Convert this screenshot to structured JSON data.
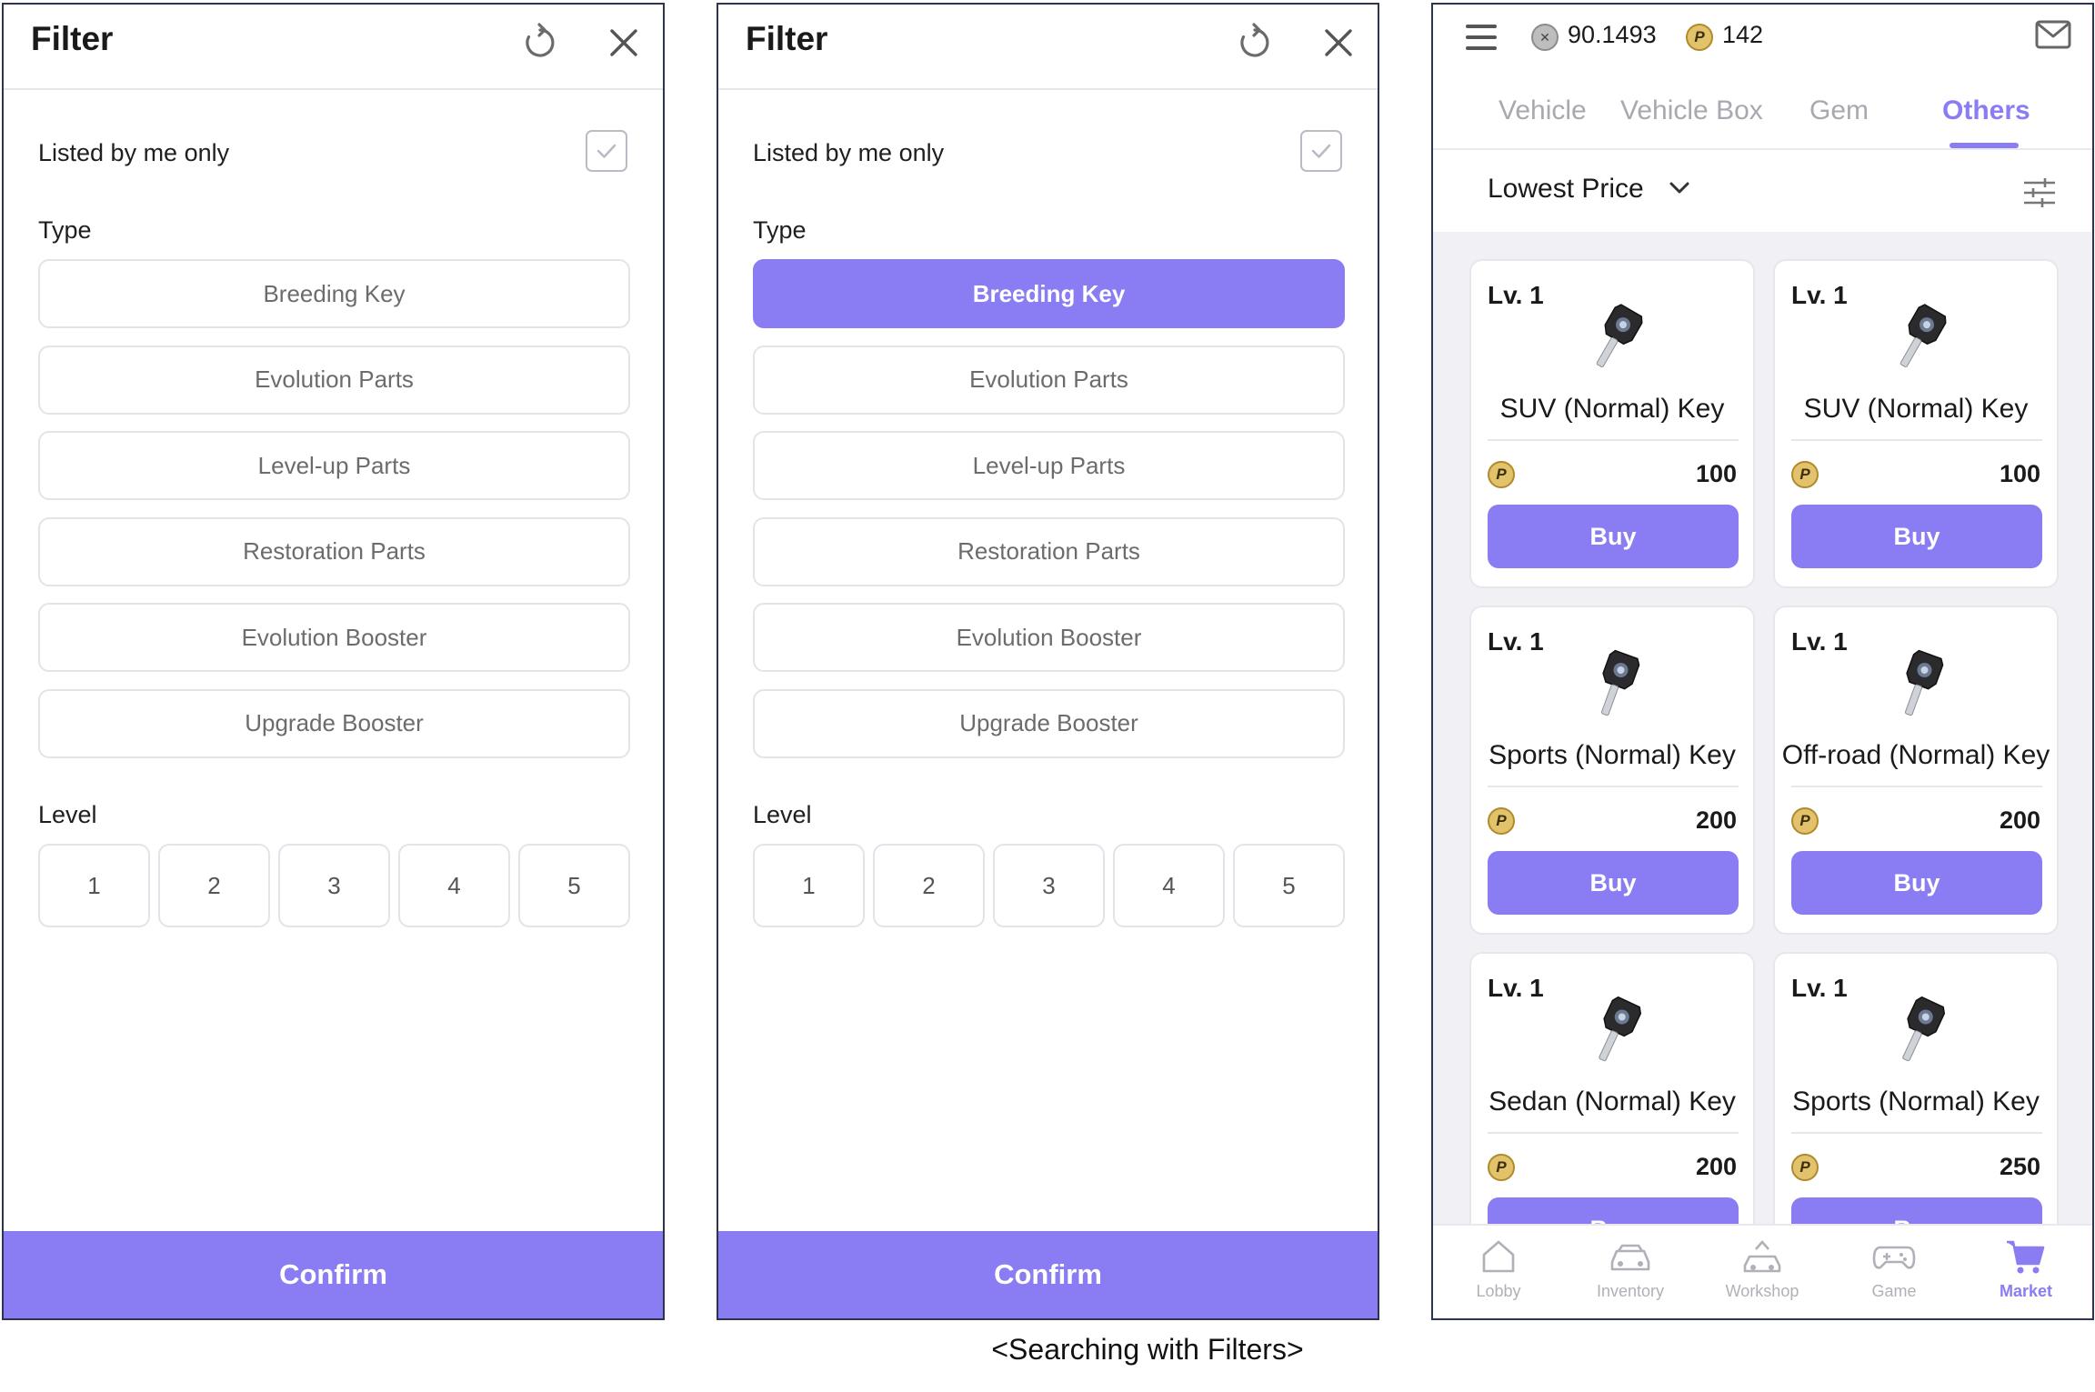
{
  "filter_panels": [
    {
      "title": "Filter",
      "listed_label": "Listed by me only",
      "type_label": "Type",
      "types": [
        "Breeding Key",
        "Evolution Parts",
        "Level-up Parts",
        "Restoration Parts",
        "Evolution Booster",
        "Upgrade Booster"
      ],
      "active_type": null,
      "level_label": "Level",
      "levels": [
        "1",
        "2",
        "3",
        "4",
        "5"
      ],
      "confirm": "Confirm"
    },
    {
      "title": "Filter",
      "listed_label": "Listed by me only",
      "type_label": "Type",
      "types": [
        "Breeding Key",
        "Evolution Parts",
        "Level-up Parts",
        "Restoration Parts",
        "Evolution Booster",
        "Upgrade Booster"
      ],
      "active_type": "Breeding Key",
      "level_label": "Level",
      "levels": [
        "1",
        "2",
        "3",
        "4",
        "5"
      ],
      "confirm": "Confirm"
    }
  ],
  "caption": "<Searching with Filters>",
  "market": {
    "balance_x": "90.1493",
    "balance_p": "142",
    "tabs": [
      "Vehicle",
      "Vehicle Box",
      "Gem",
      "Others"
    ],
    "active_tab": "Others",
    "sort": "Lowest Price",
    "cards": [
      {
        "level": "Lv. 1",
        "name": "SUV (Normal) Key",
        "price": "100",
        "buy": "Buy"
      },
      {
        "level": "Lv. 1",
        "name": "SUV (Normal) Key",
        "price": "100",
        "buy": "Buy"
      },
      {
        "level": "Lv. 1",
        "name": "Sports (Normal) Key",
        "price": "200",
        "buy": "Buy"
      },
      {
        "level": "Lv. 1",
        "name": "Off-road (Normal) Key",
        "price": "200",
        "buy": "Buy"
      },
      {
        "level": "Lv. 1",
        "name": "Sedan (Normal) Key",
        "price": "200",
        "buy": "Buy"
      },
      {
        "level": "Lv. 1",
        "name": "Sports (Normal) Key",
        "price": "250",
        "buy": "Buy"
      }
    ],
    "nav": [
      "Lobby",
      "Inventory",
      "Workshop",
      "Game",
      "Market"
    ],
    "active_nav": "Market"
  },
  "colors": {
    "accent": "#8a7cf2",
    "border": "#2c3550"
  }
}
